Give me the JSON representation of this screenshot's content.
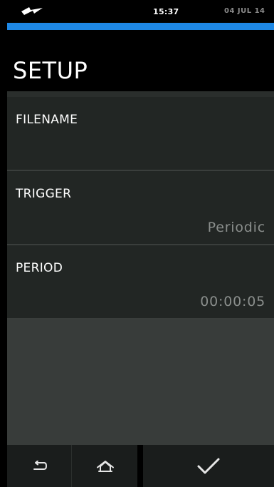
{
  "status_bar": {
    "time": "15:37",
    "date": "04 JUL 14",
    "power_icon": "lightning-plug-icon"
  },
  "colors": {
    "accent": "#1e88e5",
    "row_background": "#222624",
    "value_text": "#8a8e8c"
  },
  "page": {
    "title": "SETUP"
  },
  "rows": [
    {
      "label": "FILENAME",
      "value": ""
    },
    {
      "label": "TRIGGER",
      "value": "Periodic"
    },
    {
      "label": "PERIOD",
      "value": "00:00:05"
    }
  ],
  "nav": {
    "back_icon": "back-arrow-icon",
    "home_icon": "home-icon",
    "confirm_icon": "checkmark-icon"
  }
}
